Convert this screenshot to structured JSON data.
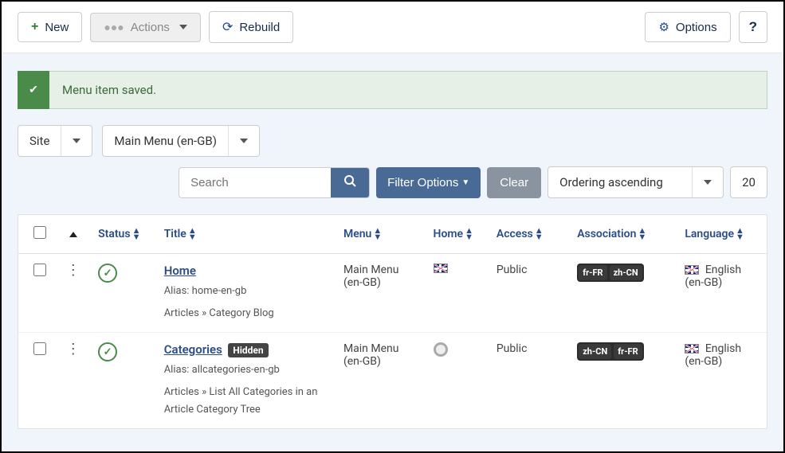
{
  "toolbar": {
    "new_label": "New",
    "actions_label": "Actions",
    "rebuild_label": "Rebuild",
    "options_label": "Options",
    "help_label": "?"
  },
  "alert": {
    "message": "Menu item saved."
  },
  "filters": {
    "client_select": "Site",
    "menu_select": "Main Menu (en-GB)",
    "search_placeholder": "Search",
    "filter_options_label": "Filter Options",
    "clear_label": "Clear",
    "ordering_label": "Ordering ascending",
    "limit": "20"
  },
  "columns": {
    "status": "Status",
    "title": "Title",
    "menu": "Menu",
    "home": "Home",
    "access": "Access",
    "association": "Association",
    "language": "Language"
  },
  "rows": [
    {
      "title": "Home",
      "alias": "Alias: home-en-gb",
      "type": "Articles » Category Blog",
      "hidden": false,
      "menu": "Main Menu (en-GB)",
      "home_flag": "uk",
      "access": "Public",
      "associations": [
        "fr-FR",
        "zh-CN"
      ],
      "language": "English (en-GB)"
    },
    {
      "title": "Categories",
      "alias": "Alias: allcategories-en-gb",
      "type": "Articles » List All Categories in an Article Category Tree",
      "hidden": true,
      "hidden_label": "Hidden",
      "menu": "Main Menu (en-GB)",
      "home_flag": "none",
      "access": "Public",
      "associations": [
        "zh-CN",
        "fr-FR"
      ],
      "language": "English (en-GB)"
    }
  ]
}
